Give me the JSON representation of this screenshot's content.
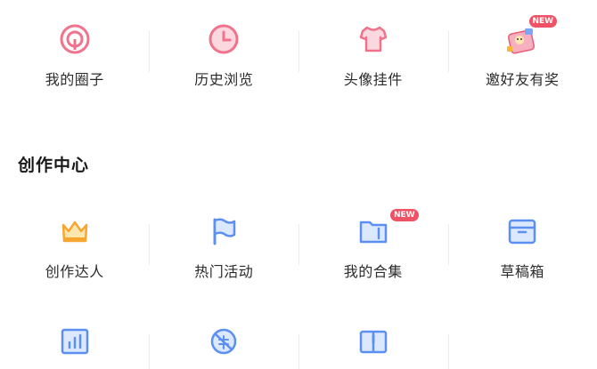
{
  "top_row": {
    "items": [
      {
        "label": "我的圈子"
      },
      {
        "label": "历史浏览"
      },
      {
        "label": "头像挂件"
      },
      {
        "label": "邀好友有奖",
        "badge": "NEW"
      }
    ]
  },
  "creation_section": {
    "title": "创作中心",
    "row1": [
      {
        "label": "创作达人"
      },
      {
        "label": "热门活动"
      },
      {
        "label": "我的合集",
        "badge": "NEW"
      },
      {
        "label": "草稿箱"
      }
    ]
  },
  "colors": {
    "pink": "#f2728c",
    "blue": "#5b8ff2",
    "badge": "#f05265",
    "crown": "#f7b731"
  }
}
